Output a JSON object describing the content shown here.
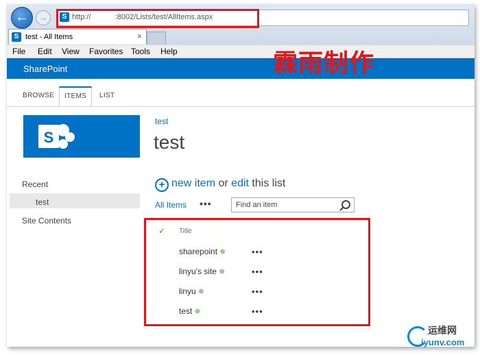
{
  "browser": {
    "address": "http://                :8002/Lists/test/AllItems.aspx",
    "tab_title": "test - All Items",
    "tab_close": "×",
    "back_glyph": "←",
    "forward_glyph": "→"
  },
  "menu": [
    "File",
    "Edit",
    "View",
    "Favorites",
    "Tools",
    "Help"
  ],
  "suite_bar": {
    "title": "SharePoint",
    "accent": "#0072c6"
  },
  "watermark": "霖雨制作",
  "ribbon_tabs": [
    "BROWSE",
    "ITEMS",
    "LIST"
  ],
  "ribbon_active": "ITEMS",
  "quick_launch": {
    "recent": "Recent",
    "recent_item": "test",
    "site_contents": "Site Contents"
  },
  "main": {
    "breadcrumb": "test",
    "title": "test",
    "new_item": "new item",
    "or": "or",
    "edit": "edit",
    "this_list": "this list",
    "view": "All Items",
    "view_more": "•••",
    "search_placeholder": "Find an item"
  },
  "list": {
    "check_header": "✓",
    "column": "Title",
    "rows": [
      {
        "title": "sharepoint"
      },
      {
        "title": "linyu's site"
      },
      {
        "title": "linyu"
      },
      {
        "title": "test"
      }
    ],
    "new_badge": "✵",
    "row_menu": "•••"
  },
  "brand": {
    "top": "运维网",
    "bottom": "iyunv.com"
  },
  "highlight_color": "#e0161b"
}
